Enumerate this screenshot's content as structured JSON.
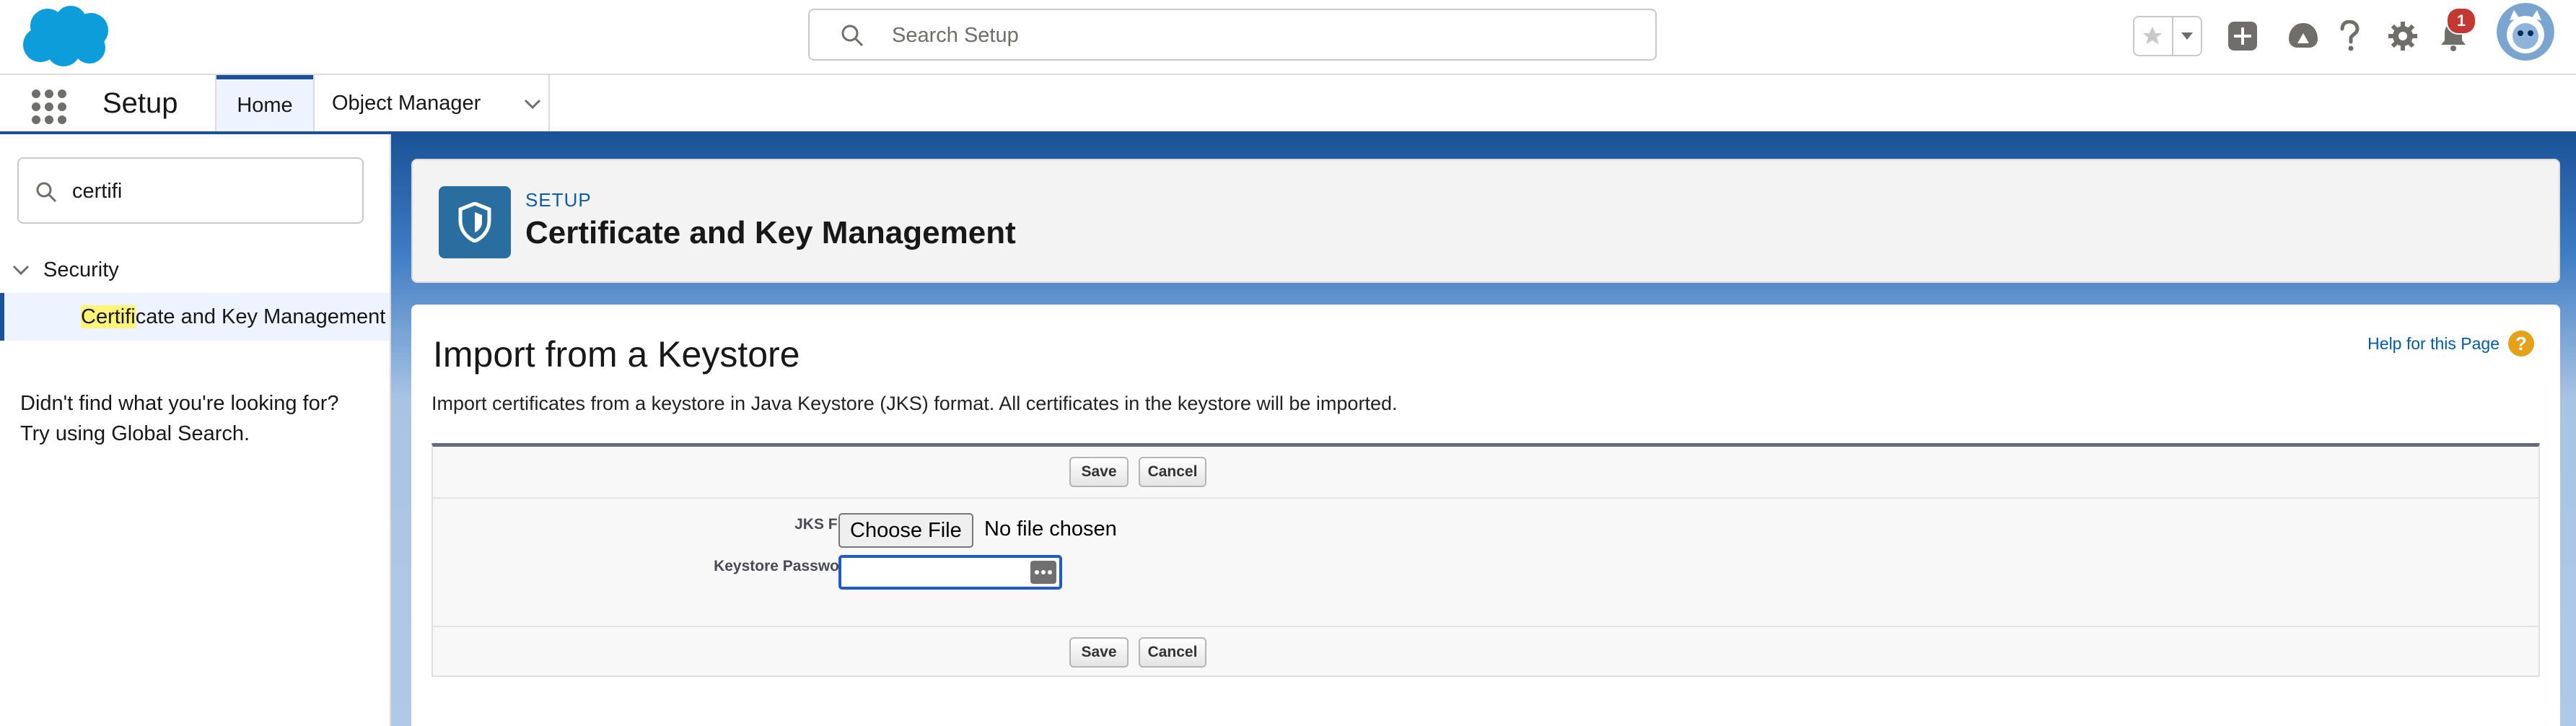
{
  "header": {
    "search_placeholder": "Search Setup",
    "notification_count": "1"
  },
  "context_bar": {
    "app_name": "Setup",
    "tabs": [
      {
        "label": "Home"
      },
      {
        "label": "Object Manager"
      }
    ]
  },
  "sidebar": {
    "quick_find_value": "certifi",
    "section_label": "Security",
    "item": {
      "highlight": "Certifi",
      "rest": "cate and Key Management"
    },
    "not_found_line1": "Didn't find what you're looking for?",
    "not_found_line2": "Try using Global Search."
  },
  "page_header": {
    "kicker": "SETUP",
    "title": "Certificate and Key Management"
  },
  "content": {
    "title": "Import from a Keystore",
    "help_link": "Help for this Page",
    "description": "Import certificates from a keystore in Java Keystore (JKS) format. All certificates in the keystore will be imported.",
    "save_label": "Save",
    "cancel_label": "Cancel",
    "jks_label": "JKS File",
    "choose_file_label": "Choose File",
    "file_status": "No file chosen",
    "password_label": "Keystore Password"
  },
  "colors": {
    "brand_blue": "#1b5297",
    "link_blue": "#0b5cab",
    "salesforce_cloud": "#0d9dda",
    "notification_red": "#c23934",
    "help_orange": "#e5a11a",
    "header_icon_teal": "#2a6ea0"
  },
  "icons": [
    "salesforce-logo",
    "search-icon",
    "star-icon",
    "dropdown-icon",
    "add-icon",
    "trailhead-icon",
    "help-icon",
    "gear-icon",
    "bell-icon",
    "avatar",
    "app-launcher-icon",
    "chevron-down-icon",
    "shield-icon",
    "key-icon"
  ]
}
